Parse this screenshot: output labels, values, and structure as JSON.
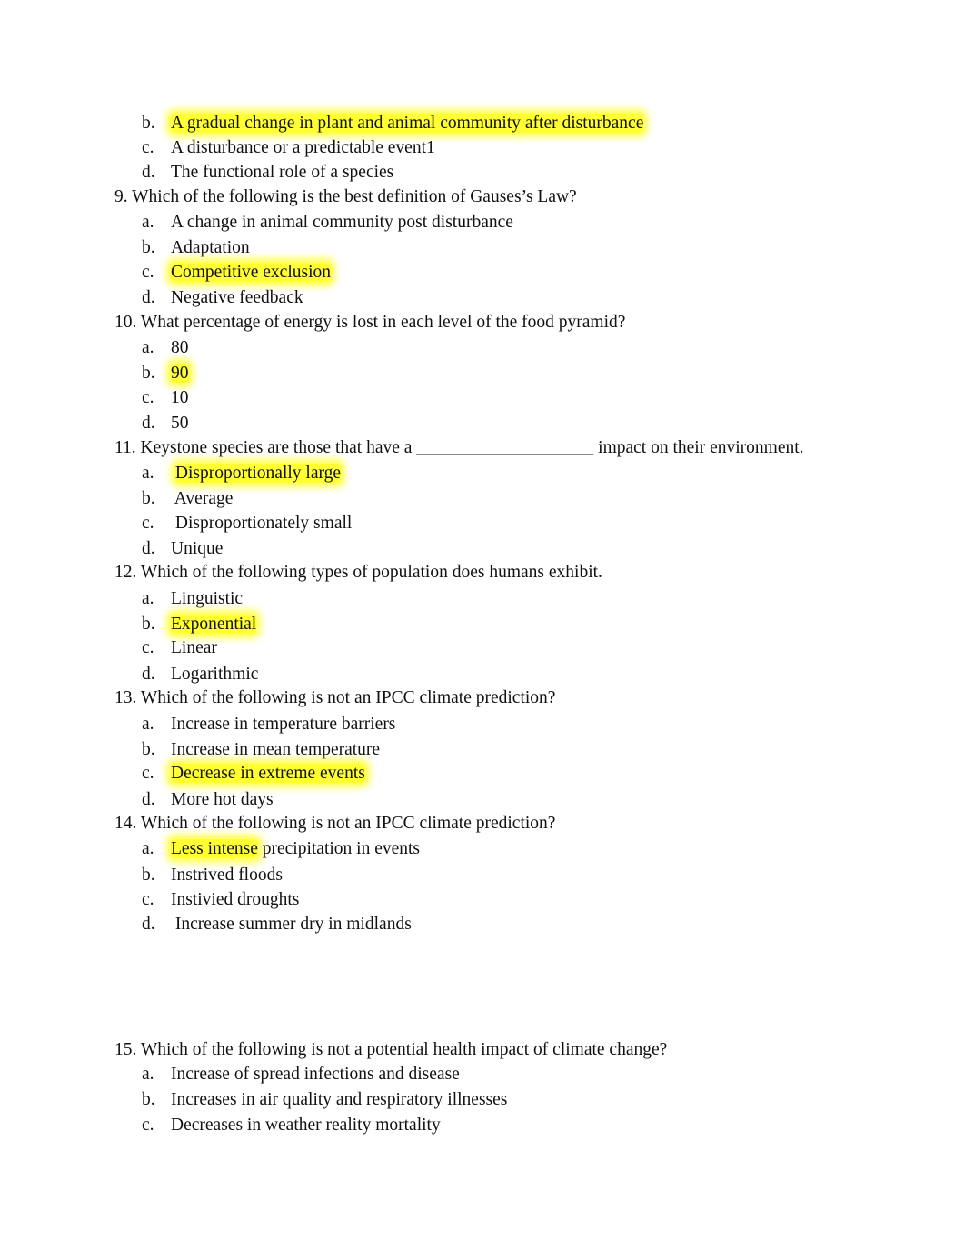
{
  "highlight_color": "#ffff33",
  "questions": [
    {
      "number": "",
      "text": "",
      "options": [
        {
          "letter": "b.",
          "pre": "",
          "highlight": "A gradual change in plant and animal community after disturbance",
          "post": ""
        },
        {
          "letter": "c.",
          "pre": "A disturbance or a predictable event1",
          "highlight": "",
          "post": ""
        },
        {
          "letter": "d.",
          "pre": "The functional role of a species",
          "highlight": "",
          "post": ""
        }
      ]
    },
    {
      "number": "9.",
      "text": "Which of the following is the best definition of Gauses’s Law?",
      "options": [
        {
          "letter": "a.",
          "pre": "A change in animal community post disturbance",
          "highlight": "",
          "post": ""
        },
        {
          "letter": "b.",
          "pre": "Adaptation",
          "highlight": "",
          "post": ""
        },
        {
          "letter": "c.",
          "pre": "",
          "highlight": "Competitive exclusion",
          "post": ""
        },
        {
          "letter": "d.",
          "pre": "Negative feedback",
          "highlight": "",
          "post": ""
        }
      ]
    },
    {
      "number": "10.",
      "text": "What percentage of energy is lost in each level of the food pyramid?",
      "options": [
        {
          "letter": "a.",
          "pre": "80",
          "highlight": "",
          "post": ""
        },
        {
          "letter": "b.",
          "pre": "",
          "highlight": "90",
          "post": ""
        },
        {
          "letter": "c.",
          "pre": "10",
          "highlight": "",
          "post": ""
        },
        {
          "letter": "d.",
          "pre": "50",
          "highlight": "",
          "post": ""
        }
      ]
    },
    {
      "number": "11.",
      "text": "Keystone species are those that have a ____________________ impact on their environment.",
      "options": [
        {
          "letter": "a.",
          "pre": " ",
          "highlight": "Disproportionally large",
          "post": ""
        },
        {
          "letter": "b.",
          "pre": " Average",
          "highlight": "",
          "post": ""
        },
        {
          "letter": "c.",
          "pre": " Disproportionately small",
          "highlight": "",
          "post": ""
        },
        {
          "letter": "d.",
          "pre": "Unique",
          "highlight": "",
          "post": ""
        }
      ]
    },
    {
      "number": "12.",
      "text": "Which of the following types of population does humans exhibit.",
      "options": [
        {
          "letter": "a.",
          "pre": "Linguistic",
          "highlight": "",
          "post": ""
        },
        {
          "letter": "b.",
          "pre": "",
          "highlight": "Exponential",
          "post": ""
        },
        {
          "letter": "c.",
          "pre": "Linear",
          "highlight": "",
          "post": ""
        },
        {
          "letter": "d.",
          "pre": "Logarithmic",
          "highlight": "",
          "post": ""
        }
      ]
    },
    {
      "number": "13.",
      "text": "Which of the following is not an IPCC climate prediction?",
      "options": [
        {
          "letter": "a.",
          "pre": "Increase in temperature barriers",
          "highlight": "",
          "post": ""
        },
        {
          "letter": "b.",
          "pre": "Increase in mean temperature",
          "highlight": "",
          "post": ""
        },
        {
          "letter": "c.",
          "pre": "",
          "highlight": "Decrease in extreme events",
          "post": ""
        },
        {
          "letter": "d.",
          "pre": "More hot days",
          "highlight": "",
          "post": ""
        }
      ]
    },
    {
      "number": "14.",
      "text": "Which of the following is not an IPCC climate prediction?",
      "options": [
        {
          "letter": "a.",
          "pre": "",
          "highlight": "Less intense",
          "post": " precipitation in events"
        },
        {
          "letter": "b.",
          "pre": "Instrived floods",
          "highlight": "",
          "post": ""
        },
        {
          "letter": "c.",
          "pre": "Instivied droughts",
          "highlight": "",
          "post": ""
        },
        {
          "letter": "d.",
          "pre": " Increase summer dry in midlands",
          "highlight": "",
          "post": ""
        }
      ]
    },
    {
      "number": "15.",
      "text": "Which of the following is not a potential health impact of climate change?",
      "options": [
        {
          "letter": "a.",
          "pre": "Increase of spread infections and disease",
          "highlight": "",
          "post": ""
        },
        {
          "letter": "b.",
          "pre": "Increases in air quality and respiratory illnesses",
          "highlight": "",
          "post": ""
        },
        {
          "letter": "c.",
          "pre": "Decreases in weather reality mortality",
          "highlight": "",
          "post": ""
        }
      ]
    }
  ]
}
